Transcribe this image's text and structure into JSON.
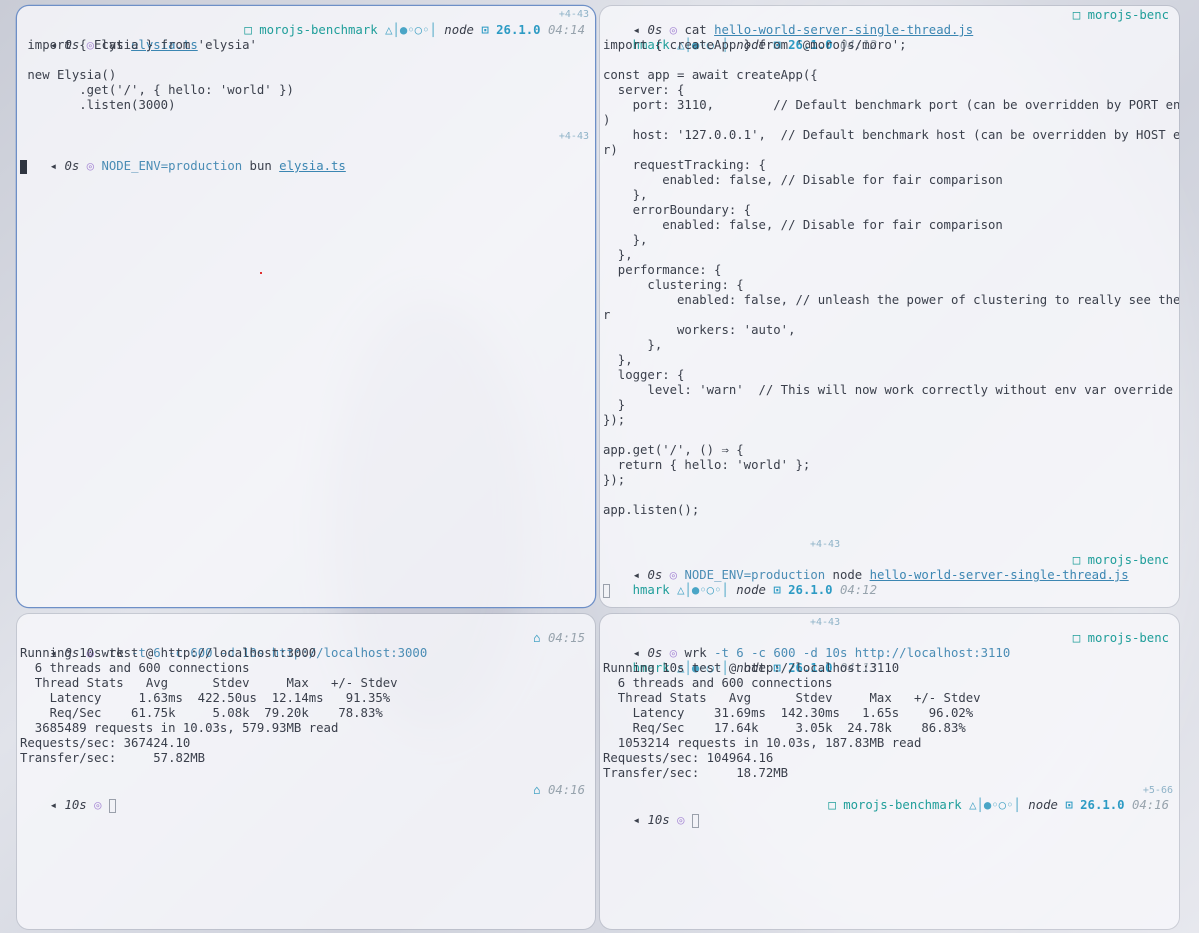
{
  "colors": {
    "accent_teal": "#1f9e9a",
    "link_blue": "#3b86b2",
    "node_blue": "#2d9bc4",
    "purple_dot": "#a88ad6",
    "active_border": "#6d8fc7"
  },
  "icons": {
    "prompt": "arrow-left-icon",
    "status": "circle-dot-icon",
    "repo": "repo-square-icon",
    "git": "git-branch-icon",
    "node": "node-icon",
    "home": "home-icon"
  },
  "top_left": {
    "git_delta": "+4-43",
    "git_delta2": "+4-43",
    "prompt1": {
      "duration": "0s",
      "cmd": "cat",
      "file": "elysia.ts",
      "repo": "morojs-benchmark",
      "git": "△│●◦○◦│",
      "runtime": "node",
      "node_symbol": "⊡",
      "version": "26.1.0",
      "time": "04:14"
    },
    "code": [
      " import { Elysia } from 'elysia'",
      "",
      " new Elysia()",
      "        .get('/', { hello: 'world' })",
      "        .listen(3000)"
    ],
    "prompt2": {
      "duration": "0s",
      "env": "NODE_ENV=production",
      "cmd": "bun",
      "file": "elysia.ts"
    }
  },
  "top_right": {
    "prompt1": {
      "duration": "0s",
      "cmd": "cat",
      "file": "hello-world-server-single-thread.js",
      "repo": "morojs-benc",
      "repo_wrap": "hmark",
      "git": "△│●◦○◦│",
      "runtime": "node",
      "node_symbol": "⊡",
      "version": "26.1.0",
      "time": "04:12"
    },
    "code": [
      "import { createApp } from '@morojs/moro';",
      "",
      "const app = await createApp({",
      "  server: {",
      "    port: 3110,        // Default benchmark port (can be overridden by PORT env var",
      ")",
      "    host: '127.0.0.1',  // Default benchmark host (can be overridden by HOST env va",
      "r)",
      "    requestTracking: {",
      "        enabled: false, // Disable for fair comparison",
      "    },",
      "    errorBoundary: {",
      "        enabled: false, // Disable for fair comparison",
      "    },",
      "  },",
      "  performance: {",
      "      clustering: {",
      "          enabled: false, // unleash the power of clustering to really see the powe",
      "r",
      "          workers: 'auto',",
      "      },",
      "  },",
      "  logger: {",
      "      level: 'warn'  // This will now work correctly without env var override",
      "  }",
      "});",
      "",
      "app.get('/', () ⇒ {",
      "  return { hello: 'world' };",
      "});",
      "",
      "app.listen();"
    ],
    "git_delta": "+4-43",
    "prompt2": {
      "duration": "0s",
      "env": "NODE_ENV=production",
      "cmd": "node",
      "file": "hello-world-server-single-thread.js",
      "repo": "morojs-benc",
      "repo_wrap": "hmark",
      "git": "△│●◦○◦│",
      "runtime": "node",
      "node_symbol": "⊡",
      "version": "26.1.0",
      "time": "04:12"
    }
  },
  "bottom_left": {
    "prompt1": {
      "duration": "0s",
      "cmd": "wrk",
      "args": "-t 6 -c 600 -d 10s",
      "url": "http://localhost:3000",
      "time": "04:15"
    },
    "output": [
      "Running 10s test @ http://localhost:3000",
      "  6 threads and 600 connections",
      "  Thread Stats   Avg      Stdev     Max   +/- Stdev",
      "    Latency     1.63ms  422.50us  12.14ms   91.35%",
      "    Req/Sec    61.75k     5.08k  79.20k    78.83%",
      "  3685489 requests in 10.03s, 579.93MB read",
      "Requests/sec: 367424.10",
      "Transfer/sec:     57.82MB"
    ],
    "prompt2": {
      "duration": "10s",
      "time": "04:16"
    }
  },
  "bottom_right": {
    "git_delta": "+4-43",
    "prompt1": {
      "duration": "0s",
      "cmd": "wrk",
      "args": "-t 6 -c 600 -d 10s",
      "url": "http://localhost:3110",
      "repo": "morojs-benc",
      "repo_wrap": "hmark",
      "git": "△│●◦○◦│",
      "runtime": "node",
      "node_symbol": "⊡",
      "version": "26.1.0",
      "time": "04:13"
    },
    "output": [
      "Running 10s test @ http://localhost:3110",
      "  6 threads and 600 connections",
      "  Thread Stats   Avg      Stdev     Max   +/- Stdev",
      "    Latency    31.69ms  142.30ms   1.65s    96.02%",
      "    Req/Sec    17.64k     3.05k  24.78k    86.83%",
      "  1053214 requests in 10.03s, 187.83MB read",
      "Requests/sec: 104964.16",
      "Transfer/sec:     18.72MB"
    ],
    "git_delta2": "+5-66",
    "prompt2": {
      "duration": "10s",
      "repo": "morojs-benchmark",
      "git": "△│●◦○◦│",
      "runtime": "node",
      "node_symbol": "⊡",
      "version": "26.1.0",
      "time": "04:16"
    }
  }
}
